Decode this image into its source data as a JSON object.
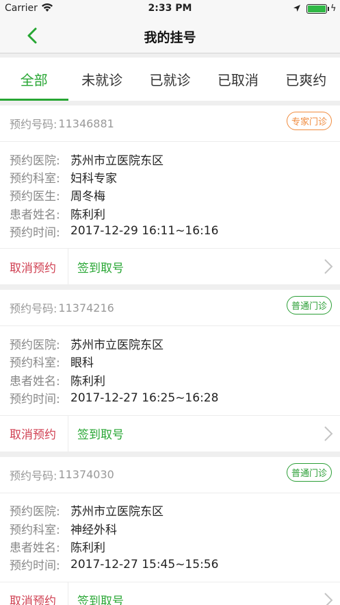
{
  "status": {
    "carrier": "Carrier",
    "time": "2:33 PM"
  },
  "nav": {
    "title": "我的挂号"
  },
  "tabs": [
    {
      "label": "全部",
      "active": true
    },
    {
      "label": "未就诊",
      "active": false
    },
    {
      "label": "已就诊",
      "active": false
    },
    {
      "label": "已取消",
      "active": false
    },
    {
      "label": "已爽约",
      "active": false
    }
  ],
  "colors": {
    "accent": "#27a633",
    "cancel": "#d04052",
    "expert_badge": "#f08a3c",
    "normal_badge": "#2a9e35"
  },
  "appointments": [
    {
      "number_label": "预约号码:",
      "number": "11346881",
      "badge": "专家门诊",
      "badge_type": "orange",
      "rows": [
        {
          "k": "预约医院:",
          "v": "苏州市立医院东区"
        },
        {
          "k": "预约科室:",
          "v": "妇科专家"
        },
        {
          "k": "预约医生:",
          "v": "周冬梅"
        },
        {
          "k": "患者姓名:",
          "v": "陈利利"
        },
        {
          "k": "预约时间:",
          "v": "2017-12-29 16:11~16:16"
        }
      ],
      "cancel_label": "取消预约",
      "checkin_label": "签到取号"
    },
    {
      "number_label": "预约号码:",
      "number": "11374216",
      "badge": "普通门诊",
      "badge_type": "green",
      "rows": [
        {
          "k": "预约医院:",
          "v": "苏州市立医院东区"
        },
        {
          "k": "预约科室:",
          "v": "眼科"
        },
        {
          "k": "患者姓名:",
          "v": "陈利利"
        },
        {
          "k": "预约时间:",
          "v": "2017-12-27 16:25~16:28"
        }
      ],
      "cancel_label": "取消预约",
      "checkin_label": "签到取号"
    },
    {
      "number_label": "预约号码:",
      "number": "11374030",
      "badge": "普通门诊",
      "badge_type": "green",
      "rows": [
        {
          "k": "预约医院:",
          "v": "苏州市立医院东区"
        },
        {
          "k": "预约科室:",
          "v": "神经外科"
        },
        {
          "k": "患者姓名:",
          "v": "陈利利"
        },
        {
          "k": "预约时间:",
          "v": "2017-12-27 15:45~15:56"
        }
      ],
      "cancel_label": "取消预约",
      "checkin_label": "签到取号"
    }
  ]
}
